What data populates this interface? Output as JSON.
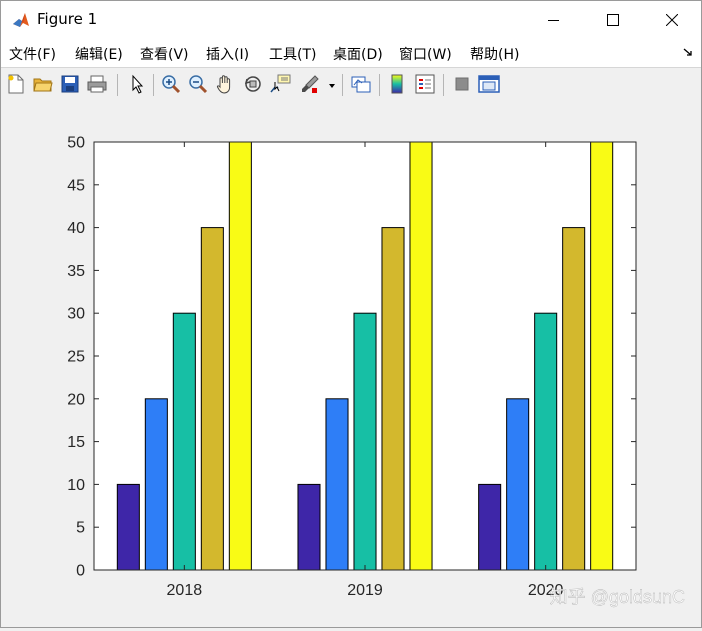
{
  "window": {
    "title": "Figure 1"
  },
  "menu": [
    {
      "label": "文件(F)"
    },
    {
      "label": "编辑(E)"
    },
    {
      "label": "查看(V)"
    },
    {
      "label": "插入(I)"
    },
    {
      "label": "工具(T)"
    },
    {
      "label": "桌面(D)"
    },
    {
      "label": "窗口(W)"
    },
    {
      "label": "帮助(H)"
    }
  ],
  "toolbar": [
    {
      "icon": "new-figure-icon"
    },
    {
      "icon": "open-file-icon"
    },
    {
      "icon": "save-icon"
    },
    {
      "icon": "print-icon"
    },
    {
      "icon": "select-arrow-icon"
    },
    {
      "icon": "zoom-in-icon"
    },
    {
      "icon": "zoom-out-icon"
    },
    {
      "icon": "pan-hand-icon"
    },
    {
      "icon": "rotate-3d-icon"
    },
    {
      "icon": "data-cursor-icon"
    },
    {
      "icon": "brush-icon"
    },
    {
      "icon": "link-plot-icon"
    },
    {
      "icon": "colorbar-icon"
    },
    {
      "icon": "legend-icon"
    },
    {
      "icon": "hide-plot-tools-icon"
    },
    {
      "icon": "show-plot-tools-icon"
    }
  ],
  "colors": {
    "bar_colors": [
      "#3e26a8",
      "#2e7ef7",
      "#17bfa5",
      "#d3b82d",
      "#f9fb15"
    ],
    "axes_background": "#ffffff",
    "figure_background": "#f0f0f0"
  },
  "chart_data": {
    "type": "bar",
    "categories": [
      "2018",
      "2019",
      "2020"
    ],
    "series": [
      {
        "values": [
          10,
          10,
          10
        ]
      },
      {
        "values": [
          20,
          20,
          20
        ]
      },
      {
        "values": [
          30,
          30,
          30
        ]
      },
      {
        "values": [
          40,
          40,
          40
        ]
      },
      {
        "values": [
          50,
          50,
          50
        ]
      }
    ],
    "ylim": [
      0,
      50
    ],
    "yticks": [
      0,
      5,
      10,
      15,
      20,
      25,
      30,
      35,
      40,
      45,
      50
    ],
    "grid": false,
    "legend": "none"
  },
  "watermark": "知乎 @goldsunC"
}
